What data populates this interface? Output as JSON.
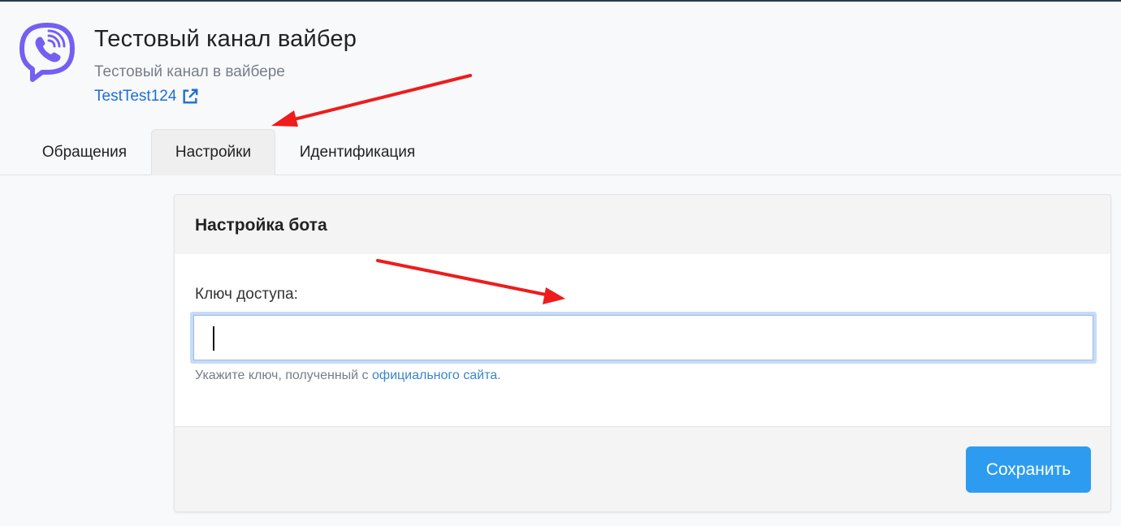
{
  "channel": {
    "title": "Тестовый канал вайбер",
    "subtitle": "Тестовый канал в вайбере",
    "link_text": "TestTest124",
    "logo_icon": "viber-icon",
    "link_icon": "external-link-icon"
  },
  "tabs": [
    {
      "label": "Обращения",
      "active": false
    },
    {
      "label": "Настройки",
      "active": true
    },
    {
      "label": "Идентификация",
      "active": false
    }
  ],
  "card": {
    "title": "Настройка бота",
    "field_label": "Ключ доступа:",
    "input_value": "",
    "help_prefix": "Укажите ключ, полученный с ",
    "help_link": "официального сайта",
    "help_suffix": ".",
    "save_label": "Сохранить"
  },
  "colors": {
    "brand": "#7360f2",
    "link": "#1e6fcf",
    "button": "#2d9cf0",
    "annotation": "#ee1c1c"
  }
}
